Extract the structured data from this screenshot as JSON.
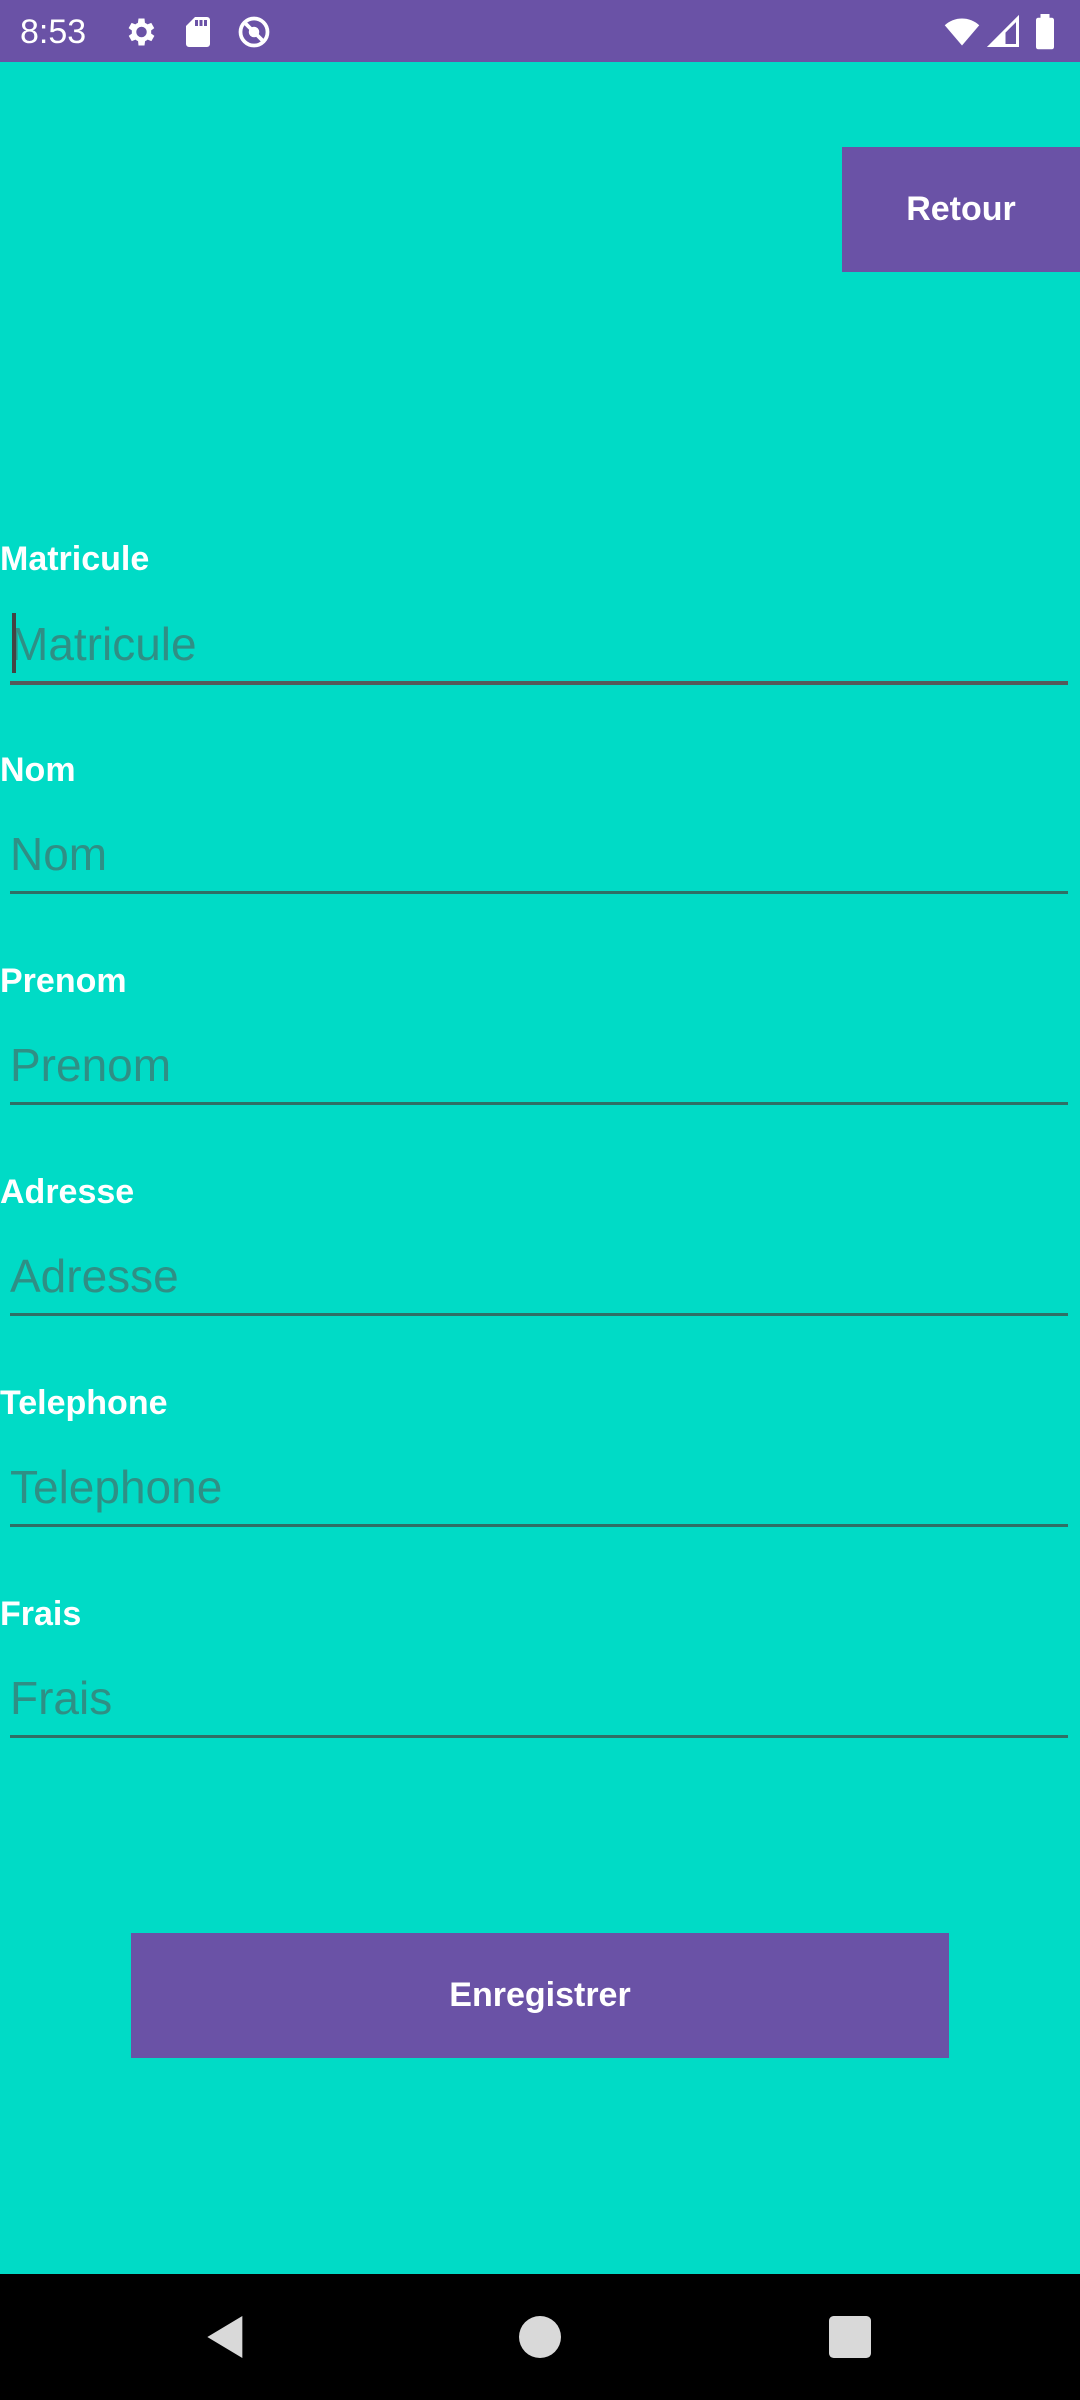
{
  "status_bar": {
    "time": "8:53",
    "left_icons": [
      "gear-icon",
      "sd-card-icon",
      "do-not-disturb-icon"
    ],
    "right_icons": [
      "wifi-icon",
      "signal-icon",
      "battery-icon"
    ],
    "background": "#6A52A6"
  },
  "header": {
    "back_label": "Retour"
  },
  "form": {
    "fields": [
      {
        "label": "Matricule",
        "placeholder": "Matricule",
        "value": ""
      },
      {
        "label": "Nom",
        "placeholder": "Nom",
        "value": ""
      },
      {
        "label": "Prenom",
        "placeholder": "Prenom",
        "value": ""
      },
      {
        "label": "Adresse",
        "placeholder": "Adresse",
        "value": ""
      },
      {
        "label": "Telephone",
        "placeholder": "Telephone",
        "value": ""
      },
      {
        "label": "Frais",
        "placeholder": "Frais",
        "value": ""
      }
    ],
    "save_label": "Enregistrer"
  },
  "nav_bar": {
    "buttons": [
      "back-icon",
      "home-icon",
      "recents-icon"
    ]
  },
  "colors": {
    "background": "#00DBC6",
    "accent": "#6A52A6",
    "text_on_accent": "#FFFFFF"
  }
}
